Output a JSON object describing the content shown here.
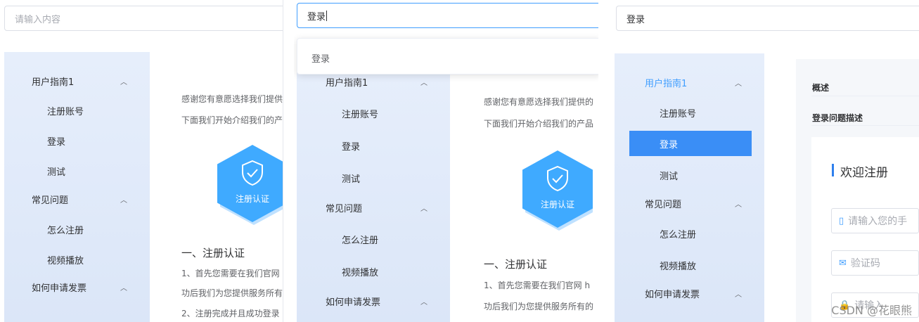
{
  "panel1": {
    "search_placeholder": "请输入内容",
    "menu": {
      "group1": "用户指南1",
      "g1_items": [
        "注册账号",
        "登录",
        "测试"
      ],
      "group2": "常见问题",
      "g2_items": [
        "怎么注册",
        "视频播放"
      ],
      "group3": "如何申请发票"
    },
    "content": {
      "line1": "感谢您有意愿选择我们提供",
      "line2": "下面我们开始介绍我们的产品",
      "badge": "注册认证",
      "heading": "一、注册认证",
      "p1": "1、首先您需要在我们官网",
      "p2": "功后我们为您提供服务所有",
      "p3": "2、注册完成并且成功登录"
    }
  },
  "panel2": {
    "search_value": "登录",
    "dropdown_option": "登录",
    "menu": {
      "group1": "用户指南1",
      "g1_items": [
        "注册账号",
        "登录",
        "测试"
      ],
      "group2": "常见问题",
      "g2_items": [
        "怎么注册",
        "视频播放"
      ],
      "group3": "如何申请发票"
    },
    "content": {
      "line1": "感谢您有意愿选择我们提供的",
      "line2": "下面我们开始介绍我们的产品",
      "badge": "注册认证",
      "heading": "一、注册认证",
      "p1": "1、首先您需要在我们官网 h",
      "p2": "功后我们为您提供服务所有的"
    }
  },
  "panel3": {
    "search_value": "登录",
    "menu": {
      "group1": "用户指南1",
      "g1_items": [
        "注册账号",
        "登录",
        "测试"
      ],
      "group2": "常见问题",
      "g2_items": [
        "怎么注册",
        "视频播放"
      ],
      "group3": "如何申请发票"
    },
    "headings": {
      "overview": "概述",
      "login_issue": "登录问题描述"
    },
    "form": {
      "welcome": "欢迎注册",
      "phone_placeholder": "请输入您的手",
      "code_placeholder": "验证码",
      "third_placeholder": "请输入"
    },
    "watermark": "CSDN @花眼熊"
  },
  "colors": {
    "accent": "#409eff",
    "active_bg": "#3a8ef6",
    "badge": "#3faaff",
    "sidebar": "#e6eefb"
  },
  "icons": [
    "chevron-up-icon",
    "shield-check-icon",
    "phone-icon",
    "mail-icon",
    "lock-icon"
  ]
}
